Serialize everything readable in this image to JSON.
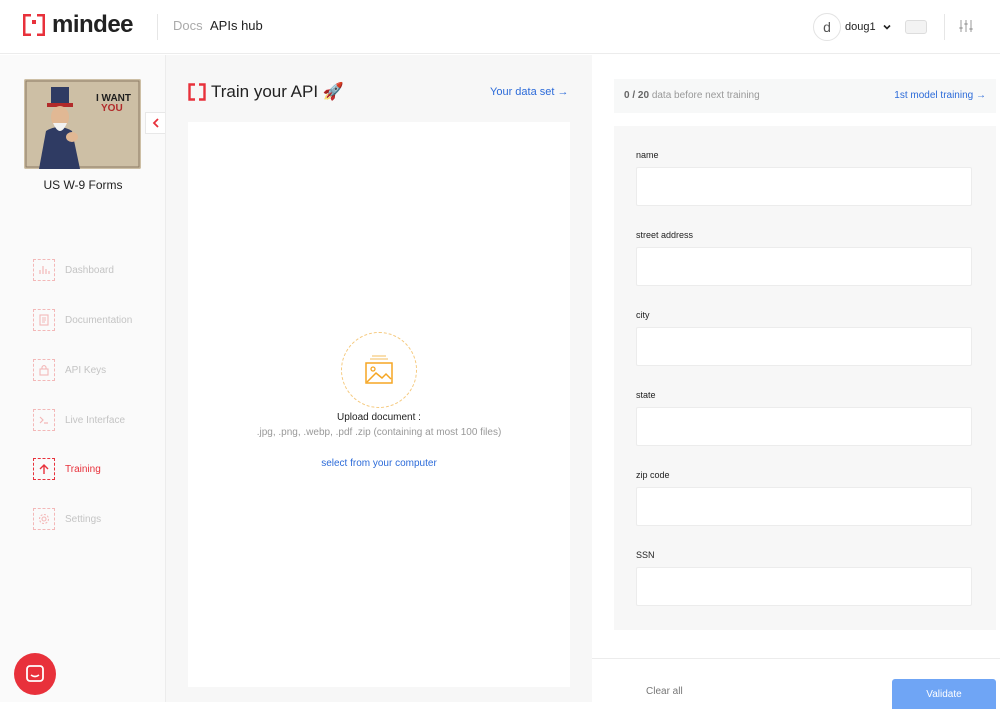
{
  "header": {
    "logo_text": "mindee",
    "nav": [
      "Docs",
      "APIs hub"
    ],
    "user": {
      "initial": "d",
      "name": "doug1"
    }
  },
  "sidebar": {
    "project_name": "US W-9 Forms",
    "poster_text": [
      "I WANT",
      "YOU"
    ],
    "items": [
      {
        "label": "Dashboard",
        "icon": "dashboard-icon",
        "active": false
      },
      {
        "label": "Documentation",
        "icon": "documentation-icon",
        "active": false
      },
      {
        "label": "API Keys",
        "icon": "lock-icon",
        "active": false
      },
      {
        "label": "Live Interface",
        "icon": "live-interface-icon",
        "active": false
      },
      {
        "label": "Training",
        "icon": "upload-arrow-icon",
        "active": true
      },
      {
        "label": "Settings",
        "icon": "gear-icon",
        "active": false
      }
    ]
  },
  "train": {
    "title": "Train your API 🚀",
    "dataset_link": "Your data set →",
    "upload_title": "Upload document :",
    "upload_hint": ".jpg, .png, .webp, .pdf .zip (containing at most 100 files)",
    "upload_link": "select from your computer"
  },
  "right": {
    "status_count": "0 / 20",
    "status_text": "data before next training",
    "status_link": "1st model training →",
    "fields": [
      {
        "label": "name",
        "value": ""
      },
      {
        "label": "street address",
        "value": ""
      },
      {
        "label": "city",
        "value": ""
      },
      {
        "label": "state",
        "value": ""
      },
      {
        "label": "zip code",
        "value": ""
      },
      {
        "label": "SSN",
        "value": ""
      }
    ],
    "clear_label": "Clear all",
    "validate_label": "Validate"
  },
  "colors": {
    "brand_red": "#e8313b",
    "link_blue": "#2c6bd9",
    "validate_blue": "#6fa5f5"
  }
}
